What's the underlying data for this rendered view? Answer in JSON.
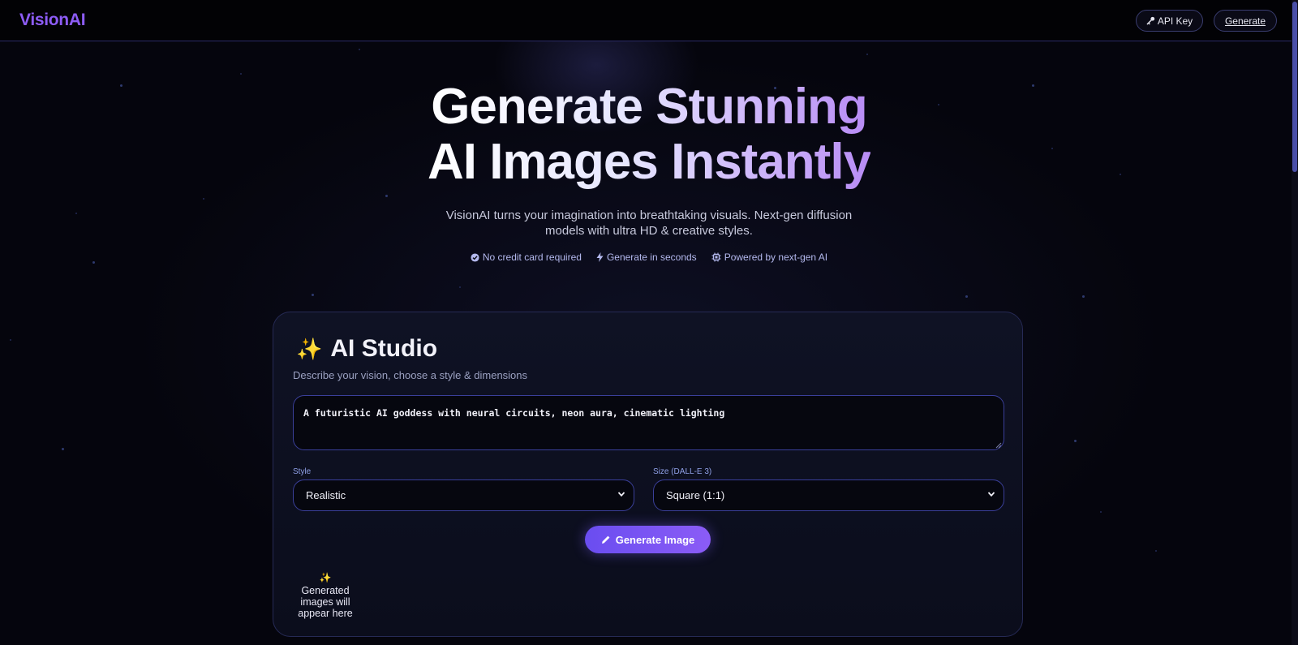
{
  "nav": {
    "brand": "VisionAI",
    "api_key_label": "API Key",
    "generate_label": "Generate"
  },
  "hero": {
    "title_line1": "Generate Stunning",
    "title_line2": "AI Images Instantly",
    "subtitle": "VisionAI turns your imagination into breathtaking visuals. Next-gen diffusion models with ultra HD & creative styles.",
    "badges": [
      {
        "icon": "check-circle-icon",
        "label": "No credit card required"
      },
      {
        "icon": "bolt-icon",
        "label": "Generate in seconds"
      },
      {
        "icon": "chip-icon",
        "label": "Powered by next-gen AI"
      }
    ]
  },
  "studio": {
    "title": "AI Studio",
    "subtitle": "Describe your vision, choose a style & dimensions",
    "prompt_value": "A futuristic AI goddess with neural circuits, neon aura, cinematic lighting",
    "style_label": "Style",
    "style_value": "Realistic",
    "size_label": "Size (DALL-E 3)",
    "size_value": "Square (1:1)",
    "generate_button": "Generate Image",
    "placeholder_text": "Generated images will appear here"
  },
  "colors": {
    "accent": "#8b5cf6",
    "background": "#05050d",
    "border": "#3a3f9a"
  }
}
